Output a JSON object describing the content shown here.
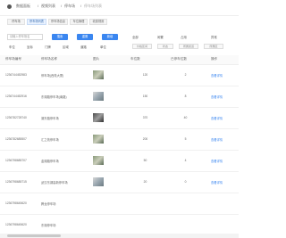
{
  "header": {
    "crumbs": [
      "数据面板",
      "视频列表",
      "停车场",
      "停车场列表"
    ]
  },
  "tabs": [
    "停车场",
    "停车场列表",
    "停车场信息",
    "车位管理",
    "收费规则"
  ],
  "filters": {
    "input_placeholder": "请输入停车场名",
    "search_label": "搜索",
    "reset_label": "重置",
    "add_label": "新增",
    "status_labels": [
      "全部",
      "闲置",
      "占用",
      "异常"
    ],
    "row_labels": [
      "车位",
      "坐标",
      "门牌",
      "区域",
      "道路",
      "单位",
      "价格区间",
      "状态",
      "所属街道",
      "所属区",
      "所属商圈"
    ],
    "sort_labels": [
      "按距离排序",
      "按价格排序"
    ]
  },
  "table": {
    "columns": [
      "停车场编号",
      "停车场名称",
      "图片",
      "",
      "车位数",
      "已停车位数",
      "操作"
    ],
    "rows": [
      {
        "id": "1236744452983",
        "name": "停车场(西苑大厦)",
        "total": "120",
        "used": "2",
        "action": "查看详情",
        "img": "a"
      },
      {
        "id": "1236744452916",
        "name": "东湖路停车场(南路)",
        "total": "150",
        "used": "8",
        "action": "查看详情",
        "img": "b"
      },
      {
        "id": "1236782728740",
        "name": "湖东路停车场",
        "total": "370",
        "used": "40",
        "action": "查看详情",
        "img": "c"
      },
      {
        "id": "1236782685507",
        "name": "汇之苑停车场",
        "total": "200",
        "used": "5",
        "action": "查看详情",
        "img": "d"
      },
      {
        "id": "1236798685707",
        "name": "金湖路停车场",
        "total": "50",
        "used": "4",
        "action": "查看详情",
        "img": "a"
      },
      {
        "id": "1236798685715",
        "name": "武汉东湖高新停车场",
        "total": "20",
        "used": "0",
        "action": "查看详情",
        "img": "b"
      },
      {
        "id": "1236798645620",
        "name": "腾龙停车场",
        "total": "",
        "used": "",
        "action": "",
        "img": "e"
      },
      {
        "id": "1236798645620",
        "name": "东湖停车场",
        "total": "",
        "used": "",
        "action": "",
        "img": "e"
      }
    ]
  }
}
